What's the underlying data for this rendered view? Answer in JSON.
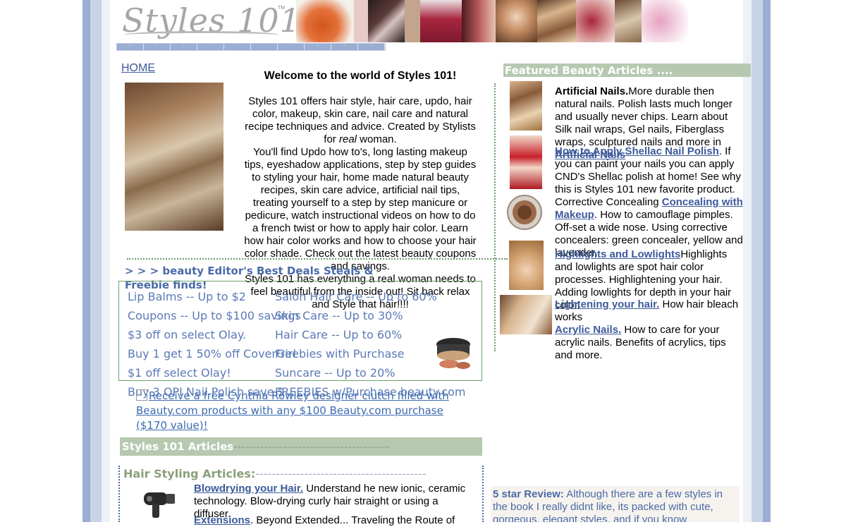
{
  "header": {
    "logo_text": "Styles 101",
    "logo_tm": "TM",
    "nav_items": [
      "-",
      "-",
      "-",
      "-",
      "-",
      "-",
      "-",
      "-",
      "-",
      "-"
    ]
  },
  "left": {
    "home_link": "HOME",
    "welcome_title": "Welcome to the world of Styles 101!",
    "welcome_p1_a": "Styles 101 offers hair style, hair care, updo, hair color, makeup, skin care, nail care and natural recipe techniques and advice. Created by Stylists for ",
    "welcome_p1_em": "real",
    "welcome_p1_b": " woman.",
    "welcome_p2": "You'll find Updo how to's, long lasting makeup tips, eyeshadow applications, step by step guides to styling your hair, home made natural beauty recipes, skin care advice, artificial nail tips, treating yourself to a step by step manicure or pedicure, watch instructional videos on how to do a french twist or how to apply hair color. Learn how hair color works and how to choose your hair color shade. Check out the latest beauty coupons and savings.",
    "welcome_p3": "Styles 101 has everything a real woman needs to feel beautiful from the inside out! Sit back relax and Style that hair!!!!",
    "deals_title": "> > > beauty Editor's Best Deals Steals & Freebie finds!",
    "deals_left": [
      "Lip Balms -- Up to $2",
      "Coupons -- Up to $100 savings",
      "$3 off on select Olay.",
      "Buy 1 get 1 50% off CoverGirl",
      "$1 off select Olay!",
      "Buy 3 OPI Nail Polish save $"
    ],
    "deals_right": [
      "Salon Hair Care -- Up to 60%",
      "Skin Care -- Up to 30%",
      "Hair Care -- Up to 60%",
      "Freebies with Purchase",
      "Suncare -- Up to 20%",
      "FREEBIES w/Purchase beauty.com"
    ],
    "promo_link": "Receive a free Cynthia Rowley designer clutch filled with Beauty.com products with any $100 Beauty.com purchase ($170 value)!",
    "articles_bar": "Styles 101 Articles",
    "articles_bar_dash": "-----------------------------------------",
    "hair_styling_title": "Hair Styling Articles:",
    "hair_styling_dash": "------------------------------------------",
    "articles": [
      {
        "link": "Blowdrying your Hair.",
        "text": " Understand he new ionic, ceramic technology. Blow-drying curly hair straight or using a diffuser."
      },
      {
        "link": "Extensions",
        "text": ". Beyond Extended... Traveling the Route of"
      }
    ]
  },
  "right": {
    "featured_title": "Featured Beauty Articles ....",
    "items": [
      {
        "bold": "Artificial Nails.",
        "text": "More durable then natural nails. Polish lasts much longer and usually never chips. Learn about Silk nail wraps, Gel nails, Fiberglass wraps, sculptured nails and more in ",
        "link": "Artificial Nails"
      },
      {
        "link": "How to Apply Shellac Nail Polish",
        "text": ". If you can paint your nails you can apply CND's Shellac polish at home! See why this is Styles 101 new favorite product."
      },
      {
        "pre": "Corrective Concealing ",
        "link": "Concealing with Makeup",
        "text": ". How to camouflage pimples. Off-set a wide nose. Using corrective concealers: green concealer, yellow and lavender."
      },
      {
        "link": "Highlights and Lowlights",
        "text": "Highlights and lowlights are spot hair color processes. Highlightening your hair. Adding lowlights for depth in your hair color."
      },
      {
        "link": "Lightening your hair.",
        "text": " How hair bleach works"
      },
      {
        "link": "Acrylic Nails.",
        "text": " How to care for your acrylic nails. Benefits of acrylics, tips and more."
      }
    ],
    "review_bold": "5 star Review:",
    "review_text": " Although there are a few styles in the book I really didnt like, its packed with cute, gorgeous, elegant styles, and if you know"
  }
}
